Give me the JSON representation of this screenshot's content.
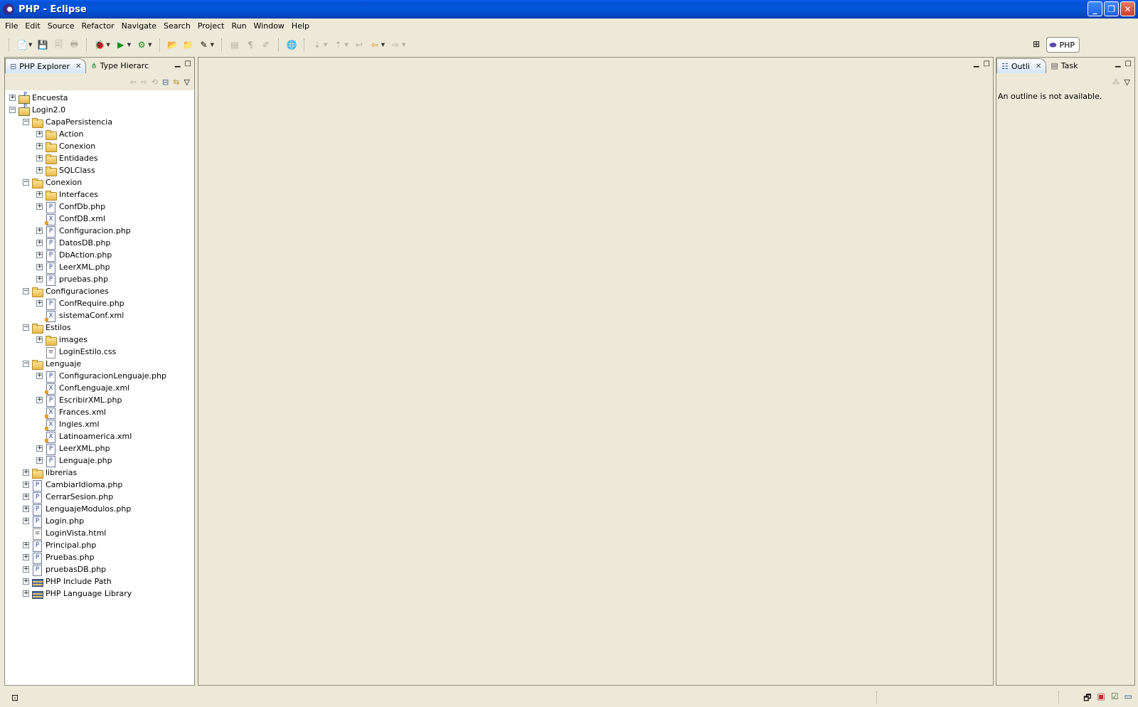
{
  "window": {
    "title": "PHP - Eclipse"
  },
  "menu": [
    "File",
    "Edit",
    "Source",
    "Refactor",
    "Navigate",
    "Search",
    "Project",
    "Run",
    "Window",
    "Help"
  ],
  "perspective": {
    "label": "PHP"
  },
  "left_panel": {
    "tabs": [
      {
        "label": "PHP Explorer",
        "active": true
      },
      {
        "label": "Type Hierarc",
        "active": false
      }
    ]
  },
  "right_panel": {
    "tabs": [
      {
        "label": "Outli",
        "active": true
      },
      {
        "label": "Task",
        "active": false
      }
    ],
    "message": "An outline is not available."
  },
  "tree": [
    {
      "label": "Encuesta",
      "level": 0,
      "icon": "project",
      "expander": "plus"
    },
    {
      "label": "Login2.0",
      "level": 0,
      "icon": "project",
      "expander": "minus"
    },
    {
      "label": "CapaPersistencia",
      "level": 1,
      "icon": "folder",
      "expander": "minus"
    },
    {
      "label": "Action",
      "level": 2,
      "icon": "folder",
      "expander": "plus"
    },
    {
      "label": "Conexion",
      "level": 2,
      "icon": "folder",
      "expander": "plus"
    },
    {
      "label": "Entidades",
      "level": 2,
      "icon": "folder",
      "expander": "plus"
    },
    {
      "label": "SQLClass",
      "level": 2,
      "icon": "folder",
      "expander": "plus"
    },
    {
      "label": "Conexion",
      "level": 1,
      "icon": "folder",
      "expander": "minus"
    },
    {
      "label": "Interfaces",
      "level": 2,
      "icon": "folder",
      "expander": "plus"
    },
    {
      "label": "ConfDb.php",
      "level": 2,
      "icon": "php",
      "expander": "plus"
    },
    {
      "label": "ConfDB.xml",
      "level": 2,
      "icon": "xml",
      "expander": "none"
    },
    {
      "label": "Configuracion.php",
      "level": 2,
      "icon": "php",
      "expander": "plus"
    },
    {
      "label": "DatosDB.php",
      "level": 2,
      "icon": "php",
      "expander": "plus"
    },
    {
      "label": "DbAction.php",
      "level": 2,
      "icon": "php",
      "expander": "plus"
    },
    {
      "label": "LeerXML.php",
      "level": 2,
      "icon": "php",
      "expander": "plus"
    },
    {
      "label": "pruebas.php",
      "level": 2,
      "icon": "php",
      "expander": "plus"
    },
    {
      "label": "Configuraciones",
      "level": 1,
      "icon": "folder",
      "expander": "minus"
    },
    {
      "label": "ConfRequire.php",
      "level": 2,
      "icon": "php",
      "expander": "plus"
    },
    {
      "label": "sistemaConf.xml",
      "level": 2,
      "icon": "xml",
      "expander": "none"
    },
    {
      "label": "Estilos",
      "level": 1,
      "icon": "folder",
      "expander": "minus"
    },
    {
      "label": "images",
      "level": 2,
      "icon": "folder",
      "expander": "plus"
    },
    {
      "label": "LoginEstilo.css",
      "level": 2,
      "icon": "file",
      "expander": "none"
    },
    {
      "label": "Lenguaje",
      "level": 1,
      "icon": "folder",
      "expander": "minus"
    },
    {
      "label": "ConfiguracionLenguaje.php",
      "level": 2,
      "icon": "php",
      "expander": "plus"
    },
    {
      "label": "ConfLenguaje.xml",
      "level": 2,
      "icon": "xml",
      "expander": "none"
    },
    {
      "label": "EscribirXML.php",
      "level": 2,
      "icon": "php",
      "expander": "plus"
    },
    {
      "label": "Frances.xml",
      "level": 2,
      "icon": "xml",
      "expander": "none"
    },
    {
      "label": "Ingles.xml",
      "level": 2,
      "icon": "xml",
      "expander": "none"
    },
    {
      "label": "Latinoamerica.xml",
      "level": 2,
      "icon": "xml",
      "expander": "none"
    },
    {
      "label": "LeerXML.php",
      "level": 2,
      "icon": "php",
      "expander": "plus"
    },
    {
      "label": "Lenguaje.php",
      "level": 2,
      "icon": "php",
      "expander": "plus"
    },
    {
      "label": "librerias",
      "level": 1,
      "icon": "folder",
      "expander": "plus"
    },
    {
      "label": "CambiarIdioma.php",
      "level": 1,
      "icon": "php",
      "expander": "plus"
    },
    {
      "label": "CerrarSesion.php",
      "level": 1,
      "icon": "php",
      "expander": "plus"
    },
    {
      "label": "LenguajeModulos.php",
      "level": 1,
      "icon": "php",
      "expander": "plus"
    },
    {
      "label": "Login.php",
      "level": 1,
      "icon": "php",
      "expander": "plus"
    },
    {
      "label": "LoginVista.html",
      "level": 1,
      "icon": "file",
      "expander": "none"
    },
    {
      "label": "Principal.php",
      "level": 1,
      "icon": "php",
      "expander": "plus"
    },
    {
      "label": "Pruebas.php",
      "level": 1,
      "icon": "php",
      "expander": "plus"
    },
    {
      "label": "pruebasDB.php",
      "level": 1,
      "icon": "php",
      "expander": "plus"
    },
    {
      "label": "PHP Include Path",
      "level": 1,
      "icon": "lib",
      "expander": "plus"
    },
    {
      "label": "PHP Language Library",
      "level": 1,
      "icon": "lib",
      "expander": "plus"
    }
  ]
}
